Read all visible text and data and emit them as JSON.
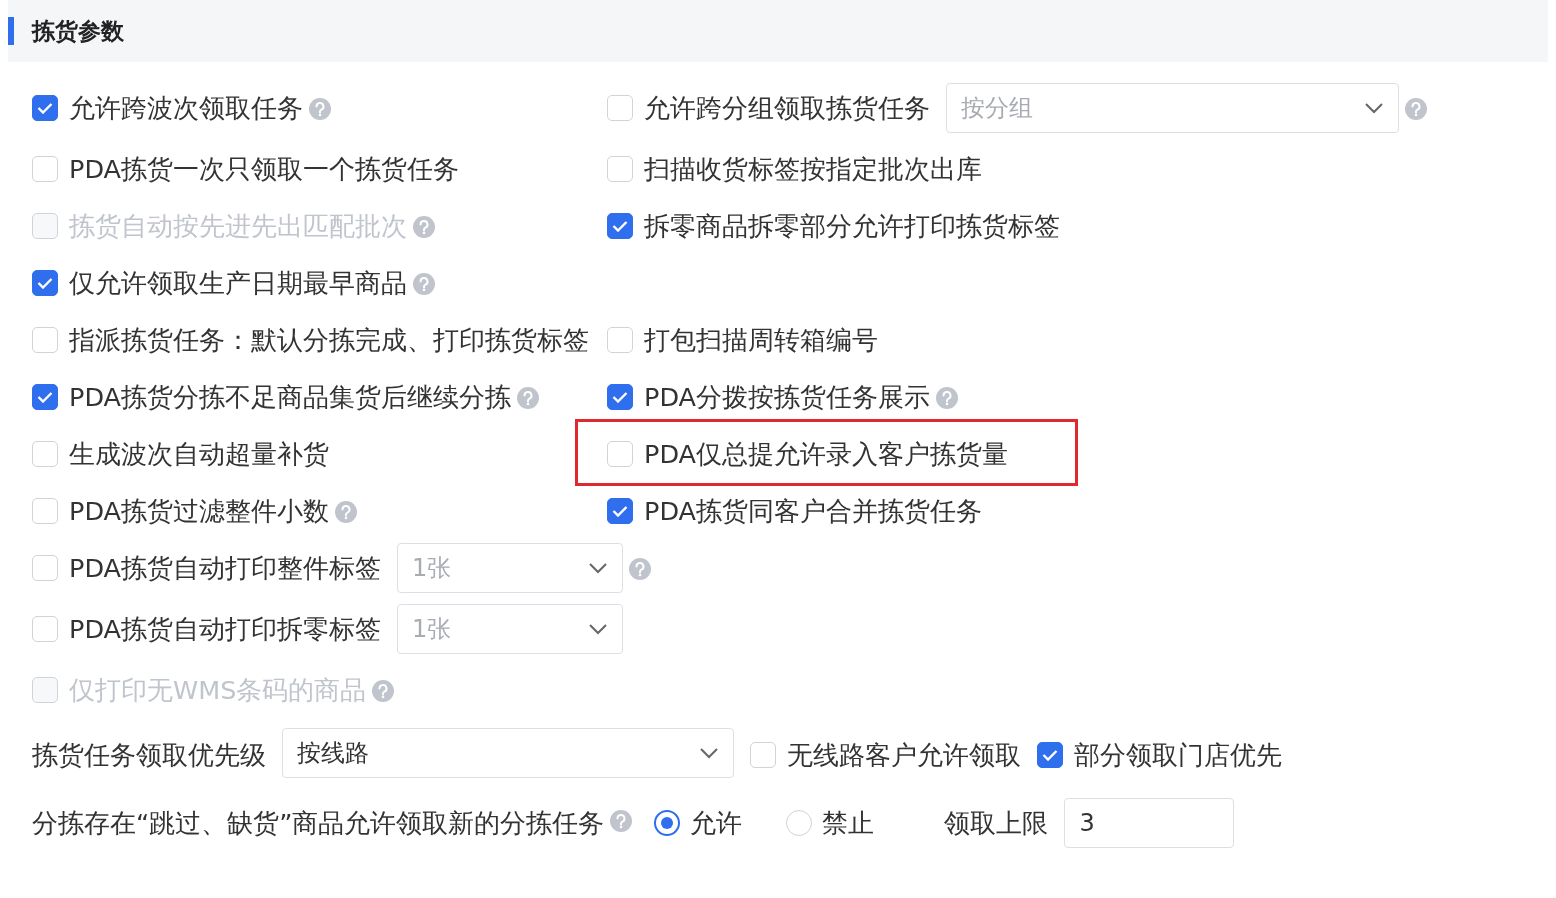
{
  "header": {
    "title": "拣货参数"
  },
  "rows": [
    {
      "left": {
        "kind": "checkbox",
        "label": "允许跨波次领取任务",
        "checked": true,
        "disabled": false,
        "help": true
      },
      "right": {
        "kind": "checkbox-select",
        "label": "允许跨分组领取拣货任务",
        "checked": false,
        "disabled": false,
        "help": true,
        "select": {
          "value": "按分组",
          "disabled": true
        }
      }
    },
    {
      "left": {
        "kind": "checkbox",
        "label": "PDA拣货一次只领取一个拣货任务",
        "checked": false,
        "disabled": false,
        "help": false
      },
      "right": {
        "kind": "checkbox",
        "label": "扫描收货标签按指定批次出库",
        "checked": false,
        "disabled": false,
        "help": false
      }
    },
    {
      "left": {
        "kind": "checkbox",
        "label": "拣货自动按先进先出匹配批次",
        "checked": false,
        "disabled": true,
        "help": true
      },
      "right": {
        "kind": "checkbox",
        "label": "拆零商品拆零部分允许打印拣货标签",
        "checked": true,
        "disabled": false,
        "help": false
      }
    },
    {
      "left": {
        "kind": "checkbox",
        "label": "仅允许领取生产日期最早商品",
        "checked": true,
        "disabled": false,
        "help": true
      }
    },
    {
      "left": {
        "kind": "checkbox",
        "label": "指派拣货任务：默认分拣完成、打印拣货标签",
        "checked": false,
        "disabled": false,
        "help": false
      },
      "right": {
        "kind": "checkbox",
        "label": "打包扫描周转箱编号",
        "checked": false,
        "disabled": false,
        "help": false
      }
    },
    {
      "left": {
        "kind": "checkbox",
        "label": "PDA拣货分拣不足商品集货后继续分拣",
        "checked": true,
        "disabled": false,
        "help": true
      },
      "right": {
        "kind": "checkbox",
        "label": "PDA分拨按拣货任务展示",
        "checked": true,
        "disabled": false,
        "help": true
      }
    },
    {
      "left": {
        "kind": "checkbox",
        "label": "生成波次自动超量补货",
        "checked": false,
        "disabled": false,
        "help": false
      },
      "right": {
        "kind": "checkbox",
        "label": "PDA仅总提允许录入客户拣货量",
        "checked": false,
        "disabled": false,
        "help": false,
        "highlighted": true
      }
    },
    {
      "left": {
        "kind": "checkbox",
        "label": "PDA拣货过滤整件小数",
        "checked": false,
        "disabled": false,
        "help": true
      },
      "right": {
        "kind": "checkbox",
        "label": "PDA拣货同客户合并拣货任务",
        "checked": true,
        "disabled": false,
        "help": false
      }
    },
    {
      "left": {
        "kind": "checkbox-select",
        "label": "PDA拣货自动打印整件标签",
        "checked": false,
        "disabled": false,
        "help": true,
        "select": {
          "value": "1张",
          "disabled": true
        }
      }
    },
    {
      "left": {
        "kind": "checkbox-select",
        "label": "PDA拣货自动打印拆零标签",
        "checked": false,
        "disabled": false,
        "help": false,
        "select": {
          "value": "1张",
          "disabled": true
        }
      }
    },
    {
      "left": {
        "kind": "checkbox",
        "label": "仅打印无WMS条码的商品",
        "checked": false,
        "disabled": true,
        "help": true
      }
    }
  ],
  "priority": {
    "label": "拣货任务领取优先级",
    "select": {
      "value": "按线路",
      "disabled": false
    },
    "options": [
      {
        "kind": "checkbox",
        "label": "无线路客户允许领取",
        "checked": false,
        "disabled": false,
        "help": false
      },
      {
        "kind": "checkbox",
        "label": "部分领取门店优先",
        "checked": true,
        "disabled": false,
        "help": false
      }
    ]
  },
  "skip_rule": {
    "label": "分拣存在“跳过、缺货”商品允许领取新的分拣任务",
    "help": true,
    "radios": [
      {
        "label": "允许",
        "selected": true
      },
      {
        "label": "禁止",
        "selected": false
      }
    ],
    "limit": {
      "label": "领取上限",
      "value": "3"
    }
  }
}
